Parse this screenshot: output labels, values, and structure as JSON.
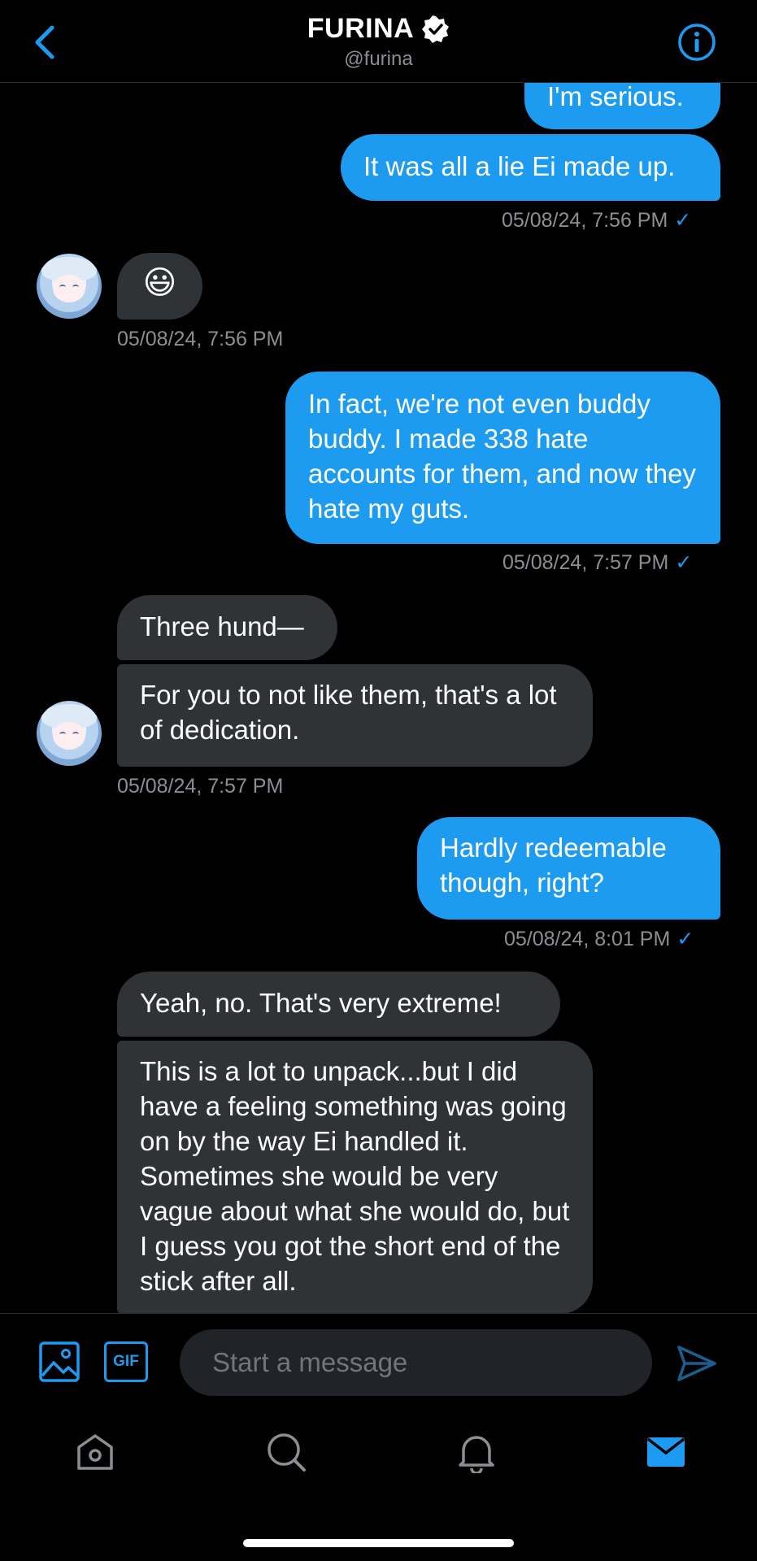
{
  "header": {
    "name": "FURINA",
    "handle": "@furina"
  },
  "messages": [
    {
      "id": "m1",
      "dir": "out",
      "text": "I'm serious."
    },
    {
      "id": "m2",
      "dir": "out",
      "text": "It was all a lie Ei made up."
    },
    {
      "id": "t1",
      "timestamp": "05/08/24, 7:56 PM",
      "check": "✓"
    },
    {
      "id": "m3",
      "dir": "in",
      "text": "😃"
    },
    {
      "id": "t2",
      "timestamp": "05/08/24, 7:56 PM"
    },
    {
      "id": "m4",
      "dir": "out",
      "text": "In fact, we're not even buddy buddy. I made 338 hate accounts for them, and now they hate my guts."
    },
    {
      "id": "t3",
      "timestamp": "05/08/24, 7:57 PM",
      "check": "✓"
    },
    {
      "id": "m5",
      "dir": "in",
      "text": "Three hund—"
    },
    {
      "id": "m6",
      "dir": "in",
      "text": "For you to not like them, that's a lot of dedication."
    },
    {
      "id": "t4",
      "timestamp": "05/08/24, 7:57 PM"
    },
    {
      "id": "m7",
      "dir": "out",
      "text": "Hardly redeemable though, right?"
    },
    {
      "id": "t5",
      "timestamp": "05/08/24, 8:01 PM",
      "check": "✓"
    },
    {
      "id": "m8",
      "dir": "in",
      "text": "Yeah, no. That's very extreme!"
    },
    {
      "id": "m9",
      "dir": "in",
      "text": "This is a lot to unpack...but I did have a feeling something was going on by the way Ei handled it. Sometimes she would be very vague about what she would do, but I guess you got the short end of the stick after all."
    }
  ],
  "composer": {
    "placeholder": "Start a message",
    "gif_label": "GIF"
  },
  "icons": {
    "back": "chevron-left-icon",
    "verified": "verified-badge-icon",
    "info": "info-icon",
    "image": "image-icon",
    "gif": "gif-icon",
    "send": "send-icon",
    "home": "home-icon",
    "search": "search-icon",
    "notifications": "bell-icon",
    "messages": "mail-icon"
  },
  "colors": {
    "accent": "#1d9bf0",
    "incoming_bubble": "#2f3336",
    "background": "#000000",
    "muted_text": "#8b8f94"
  }
}
